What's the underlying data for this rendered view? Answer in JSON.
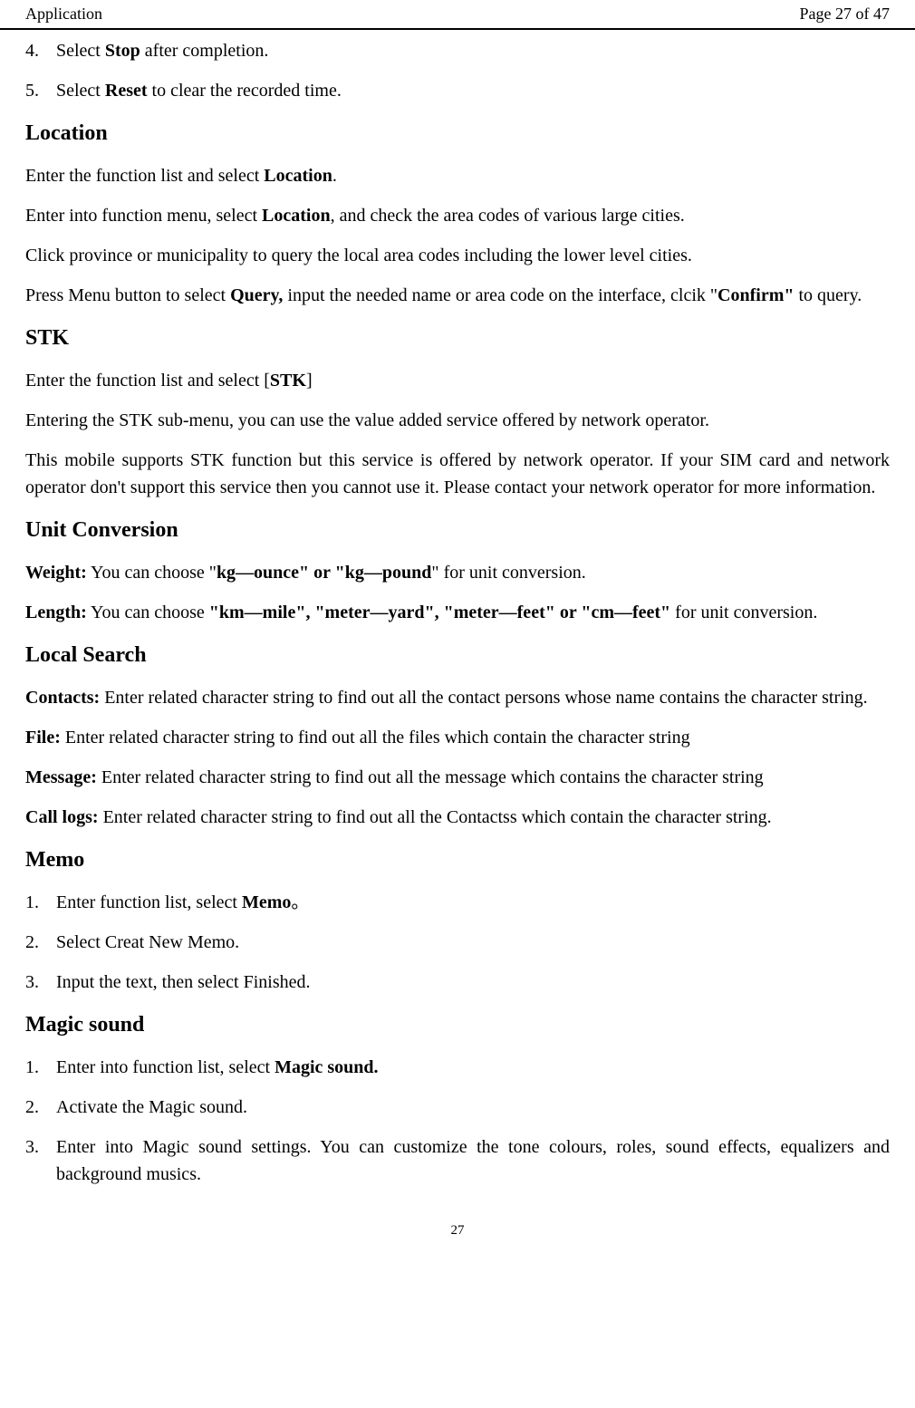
{
  "header": {
    "left": "Application",
    "right": "Page 27 of 47"
  },
  "steps_top": [
    {
      "num": "4.",
      "pre": "Select ",
      "bold": "Stop",
      "post": " after completion."
    },
    {
      "num": "5.",
      "pre": "Select ",
      "bold": "Reset",
      "post": " to clear the recorded time."
    }
  ],
  "location": {
    "heading": "Location",
    "p1_pre": "Enter the function list and select ",
    "p1_bold": "Location",
    "p1_post": ".",
    "p2_pre": "Enter into function menu, select ",
    "p2_bold": "Location",
    "p2_post": ", and check the area codes of various large cities.",
    "p3": "Click province or municipality to query the local area codes including the lower level cities.",
    "p4_pre": "Press Menu button to select ",
    "p4_bold1": "Query,",
    "p4_mid": " input the needed name or area code on the interface, clcik \"",
    "p4_bold2": "Confirm\"",
    "p4_post": " to query."
  },
  "stk": {
    "heading": "STK",
    "p1_pre": "Enter the function list and select [",
    "p1_bold": "STK",
    "p1_post": "]",
    "p2": "Entering the STK sub-menu, you can use the value added service offered by network operator.",
    "p3": "This mobile supports STK function but this service is offered by network operator. If your SIM card and network operator don't support this service then you cannot use it. Please contact your network operator for more information."
  },
  "unit": {
    "heading": "Unit Conversion",
    "weight_label": "Weight:",
    "weight_pre": " You can choose \"",
    "weight_bold": "kg—ounce\" or \"kg—pound",
    "weight_post": "\" for unit conversion.",
    "length_label": "Length:",
    "length_pre": "   You can choose ",
    "length_bold": "\"km—mile\", \"meter—yard\", \"meter—feet\" or \"cm—feet\"",
    "length_post": " for unit conversion."
  },
  "local": {
    "heading": "Local Search",
    "contacts_label": "Contacts:",
    "contacts_text": " Enter related character string to find out all the contact persons whose name contains the character string.",
    "file_label": "File:",
    "file_text": " Enter related character string to find out all the files which contain the character string",
    "message_label": "Message:",
    "message_text": " Enter related character string to find out all the message which contains the character string",
    "calllogs_label": "Call logs:",
    "calllogs_text": " Enter related character string to find out all the Contactss which contain the character string."
  },
  "memo": {
    "heading": "Memo",
    "items": [
      {
        "num": "1.",
        "pre": "Enter function list, select ",
        "bold": "Memo",
        "post": "。"
      },
      {
        "num": "2.",
        "pre": "Select Creat New Memo.",
        "bold": "",
        "post": ""
      },
      {
        "num": "3.",
        "pre": "Input the text, then select Finished.",
        "bold": "",
        "post": ""
      }
    ]
  },
  "magic": {
    "heading": "Magic sound",
    "items": [
      {
        "num": "1.",
        "pre": "Enter into function list, select ",
        "bold": "Magic sound.",
        "post": ""
      },
      {
        "num": "2.",
        "pre": "Activate the Magic sound.",
        "bold": "",
        "post": ""
      },
      {
        "num": "3.",
        "pre": "Enter into Magic sound settings. You can customize the tone colours, roles, sound effects, equalizers and background musics.",
        "bold": "",
        "post": ""
      }
    ]
  },
  "footer": "27"
}
